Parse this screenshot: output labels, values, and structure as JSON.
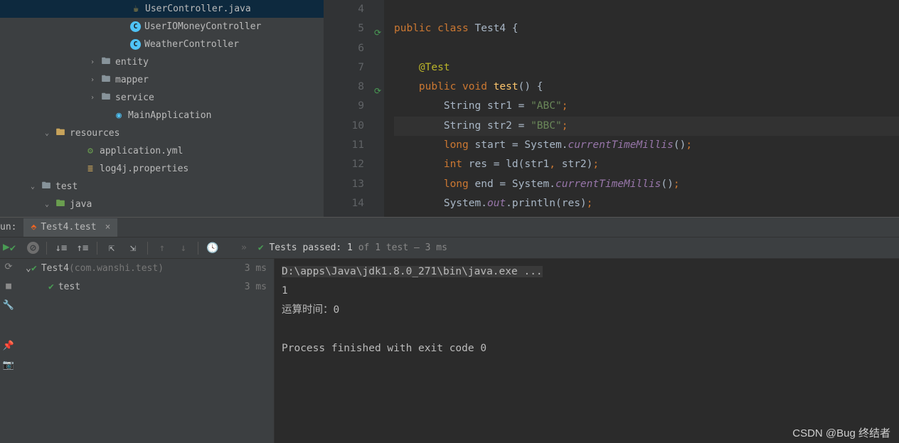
{
  "project": {
    "items": [
      {
        "indent": 166,
        "chev": "",
        "icon": "j",
        "label": "UserController.java"
      },
      {
        "indent": 166,
        "chev": "",
        "icon": "c",
        "label": "UserIOMoneyController"
      },
      {
        "indent": 166,
        "chev": "",
        "icon": "c",
        "label": "WeatherController"
      },
      {
        "indent": 124,
        "chev": "›",
        "icon": "folder",
        "label": "entity"
      },
      {
        "indent": 124,
        "chev": "›",
        "icon": "folder",
        "label": "mapper"
      },
      {
        "indent": 124,
        "chev": "›",
        "icon": "folder",
        "label": "service"
      },
      {
        "indent": 142,
        "chev": "",
        "icon": "app",
        "label": "MainApplication"
      },
      {
        "indent": 60,
        "chev": "⌄",
        "icon": "folder-res",
        "label": "resources"
      },
      {
        "indent": 102,
        "chev": "",
        "icon": "yml",
        "label": "application.yml"
      },
      {
        "indent": 102,
        "chev": "",
        "icon": "prop",
        "label": "log4j.properties"
      },
      {
        "indent": 40,
        "chev": "⌄",
        "icon": "folder-gray",
        "label": "test"
      },
      {
        "indent": 60,
        "chev": "⌄",
        "icon": "folder-green",
        "label": "java"
      }
    ]
  },
  "editor": {
    "lines": [
      {
        "num": "4",
        "html": ""
      },
      {
        "num": "5",
        "mark": true,
        "html": "<span class='kw'>public class </span><span class='ident'>Test4 </span><span class='plain'>{</span>"
      },
      {
        "num": "6",
        "html": ""
      },
      {
        "num": "7",
        "html": "    <span class='ann'>@Test</span>"
      },
      {
        "num": "8",
        "mark": true,
        "html": "    <span class='kw'>public void </span><span class='method'>test</span><span class='plain'>() {</span>"
      },
      {
        "num": "9",
        "html": "        <span class='ident'>String str1 </span><span class='plain'>= </span><span class='str'>\"ABC\"</span><span class='punc'>;</span>"
      },
      {
        "num": "10",
        "current": true,
        "html": "        <span class='ident'>String str2 </span><span class='plain'>= </span><span class='str'>\"BBC\"</span><span class='punc'>;</span>"
      },
      {
        "num": "11",
        "html": "        <span class='kw'>long </span><span class='ident'>start </span><span class='plain'>= System.</span><span class='call-i'>currentTimeMillis</span><span class='plain'>()</span><span class='punc'>;</span>"
      },
      {
        "num": "12",
        "html": "        <span class='kw'>int </span><span class='ident'>res </span><span class='plain'>= ld(str1</span><span class='punc'>, </span><span class='plain'>str2)</span><span class='punc'>;</span>"
      },
      {
        "num": "13",
        "html": "        <span class='kw'>long </span><span class='ident'>end </span><span class='plain'>= System.</span><span class='call-i'>currentTimeMillis</span><span class='plain'>()</span><span class='punc'>;</span>"
      },
      {
        "num": "14",
        "html": "        <span class='ident'>System</span><span class='plain'>.</span><span class='field'>out</span><span class='plain'>.println(res)</span><span class='punc'>;</span>"
      }
    ]
  },
  "run": {
    "label": "un:",
    "tab": "Test4.test",
    "status_prefix": "✔ ",
    "status_passed": "Tests passed: 1",
    "status_rest": " of 1 test – 3 ms",
    "tests": [
      {
        "indent": 0,
        "chev": "⌄",
        "name": "Test4",
        "pkg": " (com.wanshi.test)",
        "time": "3 ms"
      },
      {
        "indent": 24,
        "chev": "",
        "name": "test",
        "pkg": "",
        "time": "3 ms"
      }
    ],
    "console": {
      "cmd": "D:\\apps\\Java\\jdk1.8.0_271\\bin\\java.exe ...",
      "lines": [
        "1",
        "运算时间：0",
        "",
        "Process finished with exit code 0"
      ]
    }
  },
  "watermark": "CSDN @Bug 终结者"
}
